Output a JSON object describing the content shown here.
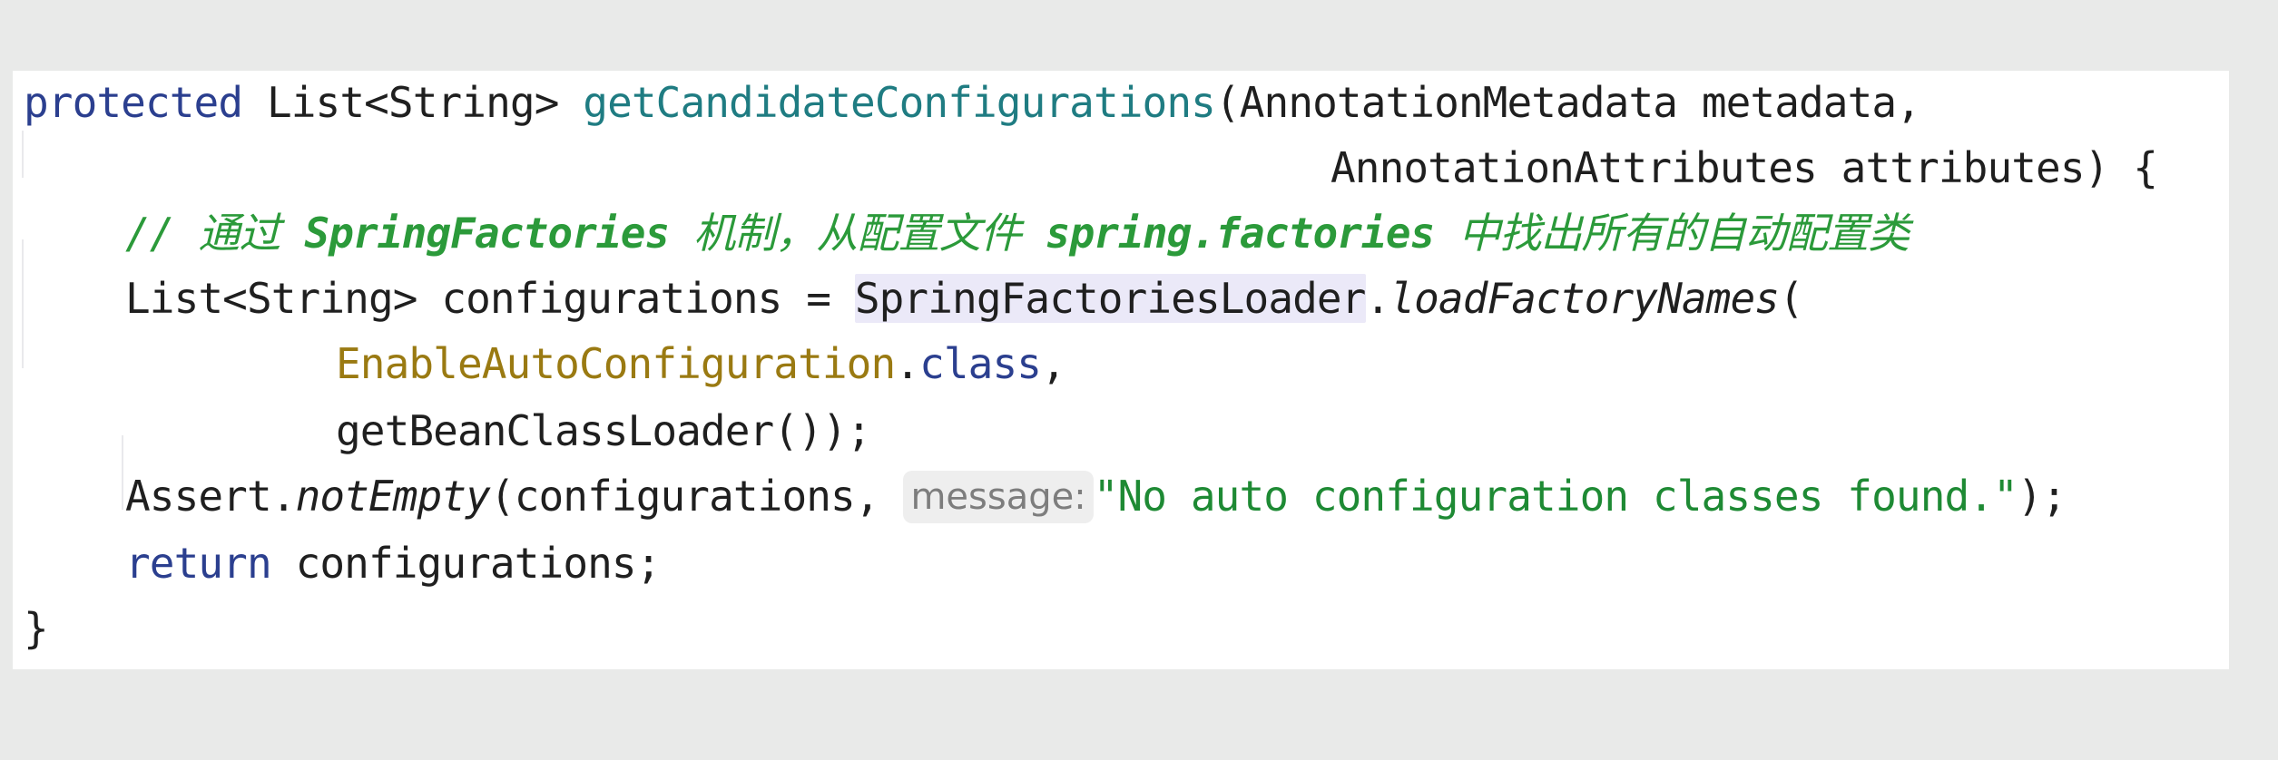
{
  "code": {
    "line1": {
      "keyword": "protected",
      "return_type": " List<String> ",
      "method_name": "getCandidateConfigurations",
      "params": "(AnnotationMetadata metadata,"
    },
    "line2": {
      "params": "AnnotationAttributes attributes) {"
    },
    "line3": {
      "comment_prefix": "// 通过 ",
      "comment_term1": "SpringFactories",
      "comment_mid": " 机制，从配置文件 ",
      "comment_term2": "spring.factories",
      "comment_suffix": " 中找出所有的自动配置类"
    },
    "line4": {
      "declaration": "List<String> configurations = ",
      "class_ref": "SpringFactoriesLoader",
      "dot": ".",
      "method_call": "loadFactoryNames",
      "open_paren": "("
    },
    "line5": {
      "annotation_class": "EnableAutoConfiguration",
      "dot": ".",
      "keyword": "class",
      "comma": ","
    },
    "line6": {
      "text": "getBeanClassLoader());"
    },
    "line7": {
      "class_ref": "Assert.",
      "method_call": "notEmpty",
      "args": "(configurations, ",
      "param_hint": "message:",
      "string_literal": "\"No auto configuration classes found.\"",
      "close": ");"
    },
    "line8": {
      "keyword": "return",
      "text": " configurations;"
    },
    "line9": {
      "text": "}"
    }
  },
  "colors": {
    "keyword": "#2b3f8f",
    "method_declaration": "#1f7c82",
    "comment": "#2b9a3a",
    "annotation": "#9a7a12",
    "string": "#1e8a34",
    "highlight": "#ebe9f8",
    "background": "#ffffff",
    "outer_background": "#e9eae9"
  }
}
